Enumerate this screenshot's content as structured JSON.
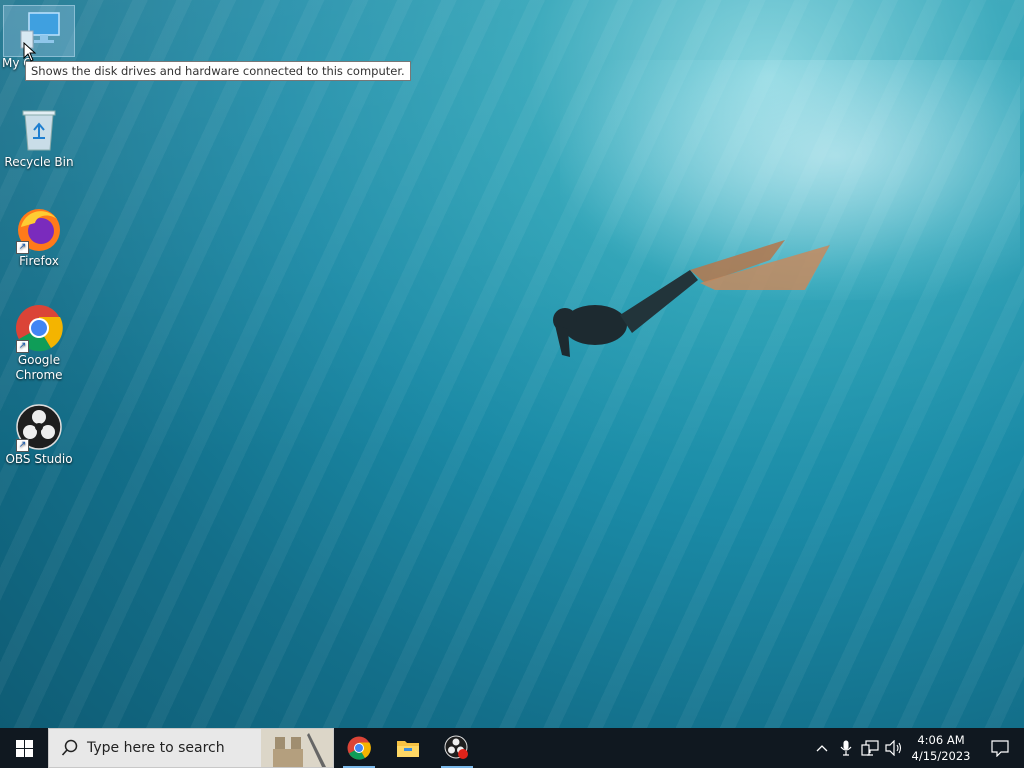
{
  "desktop": {
    "icons": [
      {
        "name": "My Computer",
        "label_visible": "My C"
      },
      {
        "name": "Recycle Bin",
        "label": "Recycle Bin"
      },
      {
        "name": "Firefox",
        "label": "Firefox"
      },
      {
        "name": "Google Chrome",
        "label": "Google Chrome"
      },
      {
        "name": "OBS Studio",
        "label": "OBS Studio"
      }
    ],
    "tooltip": "Shows the disk drives and hardware connected to this computer."
  },
  "taskbar": {
    "search_placeholder": "Type here to search",
    "pinned": [
      "Google Chrome",
      "File Explorer",
      "OBS Studio"
    ],
    "clock": {
      "time": "4:06 AM",
      "date": "4/15/2023"
    }
  },
  "colors": {
    "taskbar": "#101820",
    "accent": "#7ab8ea",
    "water": "#1a8aa6"
  }
}
